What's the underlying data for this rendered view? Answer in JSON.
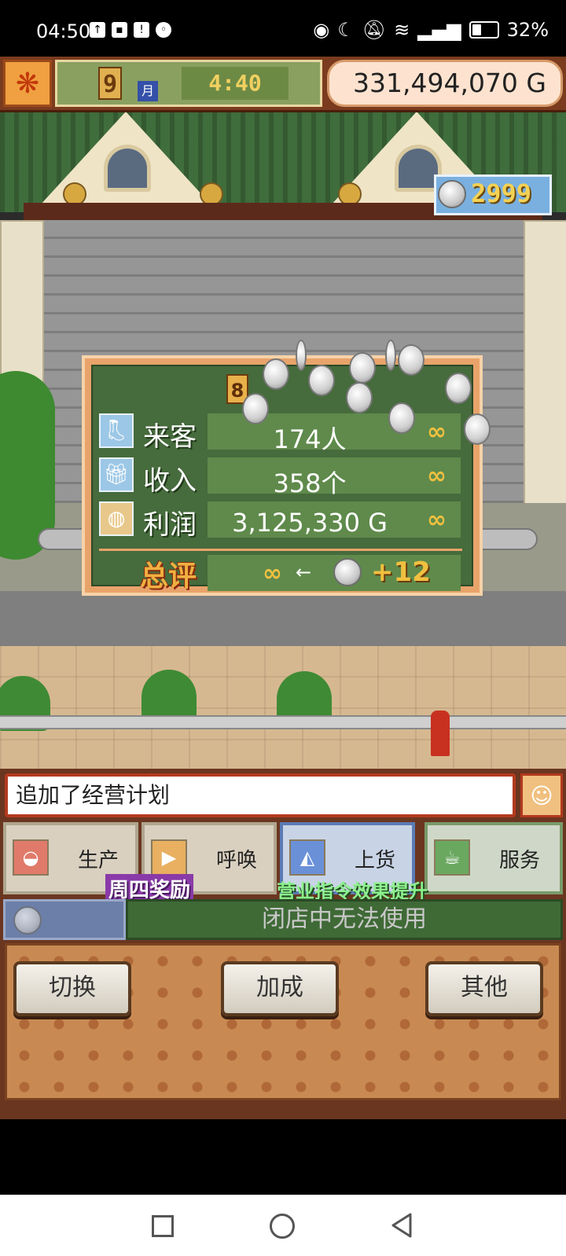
{
  "status_bar": {
    "time": "04:50",
    "battery": "32%",
    "battery_level": 0.32,
    "icons": [
      "upload-icon",
      "message-icon",
      "alert-icon",
      "wechat-icon",
      "eye-icon",
      "moon-icon",
      "mute-icon",
      "wifi-icon",
      "signal-icon",
      "battery-icon"
    ]
  },
  "hud": {
    "month_number": "9",
    "month_label": "月",
    "clock": "4:40",
    "money": "331,494,070 G"
  },
  "coin_counter": "2999",
  "result_panel": {
    "week_number": "8",
    "rows": [
      {
        "label": "来客",
        "value": "174人",
        "icon": "boot-icon",
        "rank": "∞"
      },
      {
        "label": "收入",
        "value": "358个",
        "icon": "gift-icon",
        "rank": "∞"
      },
      {
        "label": "利润",
        "value": "3,125,330 G",
        "icon": "money-bag-icon",
        "rank": "∞"
      }
    ],
    "total_label": "总评",
    "total_rank": "∞",
    "total_arrow": "←",
    "total_bonus": "+12"
  },
  "message": "追加了经营计划",
  "commands": [
    {
      "label": "生产",
      "icon": "bread-icon",
      "color": "#d9d0c0"
    },
    {
      "label": "呼唤",
      "icon": "megaphone-icon",
      "color": "#d9d0c0"
    },
    {
      "label": "上货",
      "icon": "cake-icon",
      "color": "#c8d4e6"
    },
    {
      "label": "服务",
      "icon": "coffee-icon",
      "color": "#cfd8c8"
    }
  ],
  "bonus_tags": {
    "thursday": "周四奖励",
    "command_boost": "营业指令效果提升"
  },
  "closed_message": "闭店中无法使用",
  "bottom_buttons": {
    "switch": "切换",
    "boost": "加成",
    "other": "其他"
  }
}
